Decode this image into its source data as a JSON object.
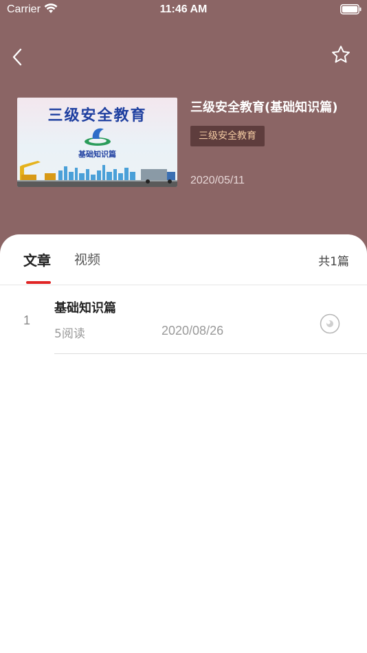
{
  "status_bar": {
    "carrier": "Carrier",
    "time": "11:46 AM"
  },
  "header": {
    "back_icon": "chevron-left-icon",
    "favorite_icon": "star-outline-icon"
  },
  "course": {
    "title": "三级安全教育(基础知识篇)",
    "tag": "三级安全教育",
    "date": "2020/05/11",
    "cover": {
      "title": "三级安全教育",
      "subtitle": "基础知识篇"
    }
  },
  "tabs": [
    {
      "label": "文章",
      "active": true
    },
    {
      "label": "视频",
      "active": false
    }
  ],
  "total_count": "共1篇",
  "articles": [
    {
      "index": "1",
      "title": "基础知识篇",
      "reads": "5阅读",
      "date": "2020/08/26",
      "icon": "eye-icon"
    }
  ],
  "colors": {
    "header_bg": "#8b6565",
    "tag_bg": "#5e3d3d",
    "tag_text": "#f3caa2",
    "accent": "#e02424"
  }
}
